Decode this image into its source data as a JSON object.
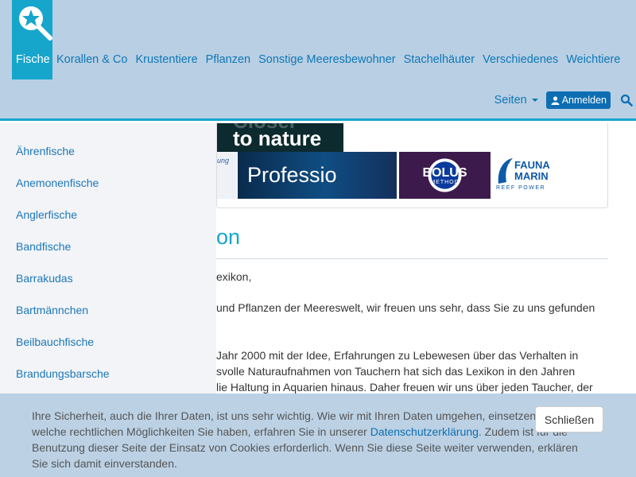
{
  "nav": {
    "items": [
      {
        "label": "Fische"
      },
      {
        "label": "Korallen & Co"
      },
      {
        "label": "Krustentiere"
      },
      {
        "label": "Pflanzen"
      },
      {
        "label": "Sonstige Meeresbewohner"
      },
      {
        "label": "Stachelhäuter"
      },
      {
        "label": "Verschiedenes"
      },
      {
        "label": "Weichtiere"
      }
    ],
    "seiten": "Seiten",
    "login": "Anmelden"
  },
  "banners": {
    "dark_faded": "Closer",
    "dark_text": "to nature",
    "left_text": "ung",
    "prof_text": "Professio",
    "bolus_title": "BOLUS",
    "bolus_sub": "METHOD",
    "fauna_1": "FAUNA",
    "fauna_2": "MARIN",
    "fauna_3": "REEF POWER"
  },
  "main": {
    "heading": "on",
    "p1": "exikon,",
    "p2_l1": "und Pflanzen der Meereswelt, wir freuen uns sehr, dass Sie zu uns gefunden",
    "p3_l1": "Jahr 2000 mit der Idee, Erfahrungen zu Lebewesen über das Verhalten in",
    "p3_l2": "svolle Naturaufnahmen von Tauchern hat sich das Lexikon in den Jahren",
    "p3_l3": "lie Haltung in Aquarien hinaus. Daher freuen wir uns über jeden Taucher, der"
  },
  "sidebar": {
    "items": [
      {
        "label": "Ährenfische"
      },
      {
        "label": "Anemonenfische"
      },
      {
        "label": "Anglerfische"
      },
      {
        "label": "Bandfische"
      },
      {
        "label": "Barrakudas"
      },
      {
        "label": "Bartmännchen"
      },
      {
        "label": "Beilbauchfische"
      },
      {
        "label": "Brandungsbarsche"
      }
    ]
  },
  "cookie": {
    "text_a": "Ihre Sicherheit, auch die Ihrer Daten, ist uns sehr wichtig. Wie wir mit Ihren Daten umgehen, einsetzen und welche rechtlichen Möglichkeiten Sie haben, erfahren Sie in unserer",
    "link": "Datenschutzerklärung",
    "text_b": ". Zudem ist für die Benutzung dieser Seite der Einsatz von Cookies erforderlich. Wenn Sie diese Seite weiter verwenden, erklären Sie sich damit einverstanden.",
    "close": "Schließen"
  },
  "colors": {
    "accent": "#16a6cc",
    "header_bg": "#b9cfe3",
    "link": "#0e78b7",
    "button": "#0e6eb3"
  }
}
